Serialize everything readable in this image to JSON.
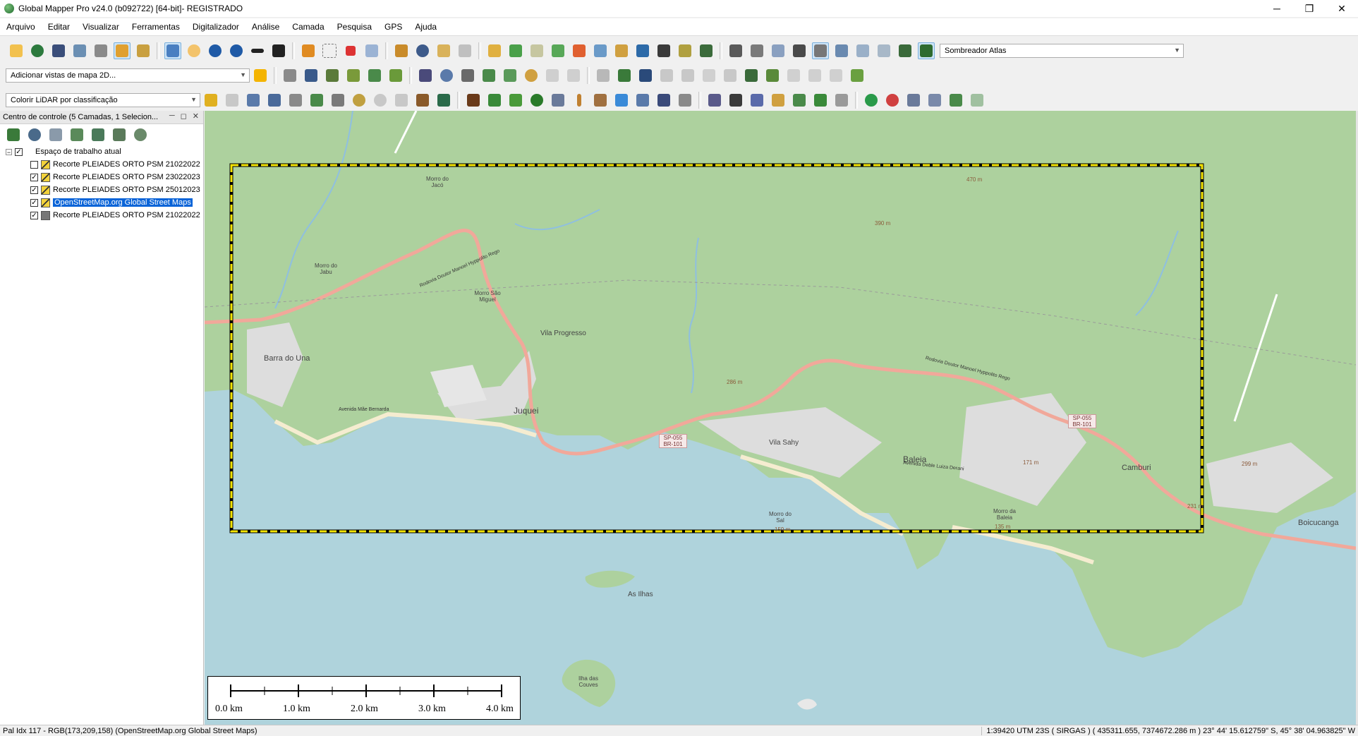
{
  "window": {
    "title": "Global Mapper Pro v24.0 (b092722) [64-bit]- REGISTRADO",
    "minimize": "─",
    "maximize": "❐",
    "close": "✕"
  },
  "menu": [
    "Arquivo",
    "Editar",
    "Visualizar",
    "Ferramentas",
    "Digitalizador",
    "Análise",
    "Camada",
    "Pesquisa",
    "GPS",
    "Ajuda"
  ],
  "toolbar": {
    "shader_combo": "Sombreador Atlas",
    "map_views_combo": "Adicionar vistas de mapa 2D...",
    "lidar_combo": "Colorir LiDAR por classificação"
  },
  "panel": {
    "header": "Centro de controle (5 Camadas, 1 Selecion...",
    "workspace": "Espaço de trabalho atual",
    "layers": [
      {
        "label": "Recorte PLEIADES ORTO PSM 21022022",
        "checked": false,
        "selected": false
      },
      {
        "label": "Recorte PLEIADES ORTO PSM 23022023",
        "checked": true,
        "selected": false
      },
      {
        "label": "Recorte PLEIADES ORTO PSM 25012023",
        "checked": true,
        "selected": false
      },
      {
        "label": "OpenStreetMap.org Global Street Maps",
        "checked": true,
        "selected": true
      },
      {
        "label": "Recorte PLEIADES ORTO PSM 21022022",
        "checked": true,
        "selected": false
      }
    ]
  },
  "map_labels": {
    "barra_do_una": "Barra do Una",
    "juquei": "Juquei",
    "vila_progresso": "Vila Progresso",
    "vila_sahy": "Vila Sahy",
    "baleia": "Baleia",
    "camburi": "Camburi",
    "boicucanga": "Boicucanga",
    "as_ilhas": "As Ilhas",
    "ilha_das_couves": "Ilha das Couves",
    "morro_do_jabu": "Morro do Jabu",
    "morro_sao_miguel": "Morro São Miguel",
    "morro_do_jaco": "Morro do Jacó",
    "morro_do_sal": "Morro do Sal",
    "morro_da_baleia": "Morro da Baleia",
    "road_rodovia_1": "Rodovia Doutor Manoel Hyppolito Rego",
    "road_rodovia_2": "Rodovia Doutor Manoel Hyppolito Rego",
    "av_mae_bernarda": "Avenida Mãe Bernarda",
    "av_deble": "Avenida Deble Luiza Derani",
    "sp055_a": "SP-055 BR-101",
    "sp055_b": "SP-055 BR-101",
    "peak_470": "470 m",
    "peak_390": "390 m",
    "peak_286": "286 m",
    "peak_171": "171 m",
    "peak_299": "299 m",
    "peak_231": "231 m",
    "peak_159": "159 m",
    "peak_135": "135 m"
  },
  "scalebar": {
    "labels": [
      "0.0 km",
      "1.0 km",
      "2.0 km",
      "3.0 km",
      "4.0 km"
    ]
  },
  "status": {
    "left": "Pal Idx 117 - RGB(173,209,158) (OpenStreetMap.org Global Street Maps)",
    "right": "1:39420  UTM 23S ( SIRGAS ) ( 435311.655, 7374672.286 m )  23° 44' 15.612759\" S, 45° 38' 04.963825\" W"
  },
  "colors": {
    "sea": "#afd3dc",
    "forest": "#add19e",
    "road": "#f1a89a",
    "urban": "#dddddd",
    "beach": "#f5ecd0",
    "selection_frame": "#f5e400"
  }
}
